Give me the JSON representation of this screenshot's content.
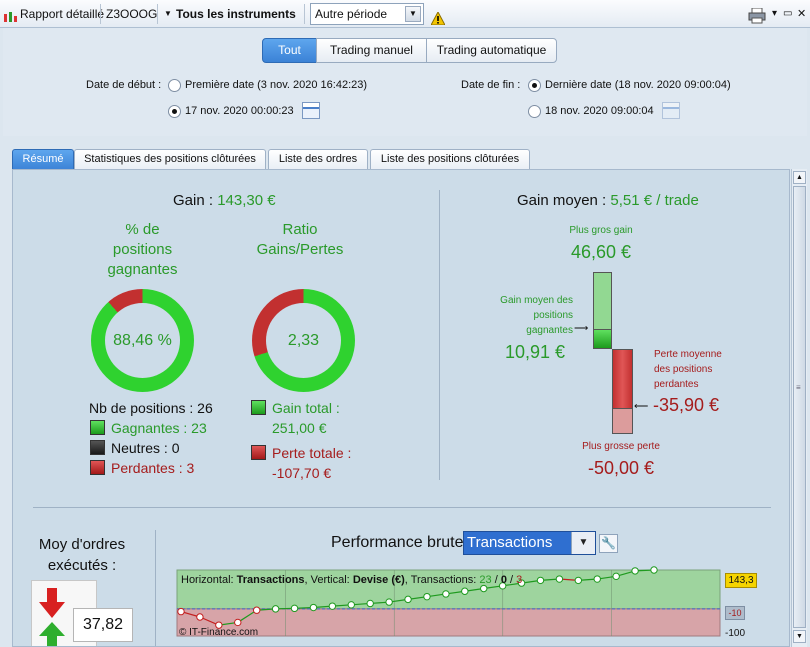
{
  "toolbar": {
    "report_label": "Rapport détaillé",
    "account": "Z3OOOG",
    "instruments": "Tous les instruments",
    "period_value": "Autre période",
    "warning_icon": "warning-icon",
    "print_icon": "printer-icon"
  },
  "filters": {
    "segments": [
      "Tout",
      "Trading manuel",
      "Trading automatique"
    ],
    "start_label": "Date de début :",
    "start_option1": "Première date (3 nov. 2020 16:42:23)",
    "start_option2": "17 nov. 2020 00:00:23",
    "end_label": "Date de fin :",
    "end_option1": "Dernière date (18 nov. 2020 09:00:04)",
    "end_option2": "18 nov. 2020 09:00:04"
  },
  "tabs": [
    "Résumé",
    "Statistiques des positions clôturées",
    "Liste des ordres",
    "Liste des positions clôturées"
  ],
  "summary": {
    "gain_label": "Gain :",
    "gain_value": "143,30 €",
    "winpct_title": "% de positions gagnantes",
    "winpct_value": "88,46 %",
    "winpct_fraction": 0.8846,
    "ratio_title": "Ratio Gains/Pertes",
    "ratio_value": "2,33",
    "ratio_fraction": 0.7,
    "nb_positions": "Nb de positions : 26",
    "winners": "Gagnantes : 23",
    "neutrals": "Neutres : 0",
    "losers": "Perdantes : 3",
    "total_gain_label": "Gain total :",
    "total_gain_value": "251,00 €",
    "total_loss_label": "Perte totale :",
    "total_loss_value": "-107,70 €"
  },
  "avg": {
    "label": "Gain moyen :",
    "value": "5,51 € / trade",
    "biggest_gain_label": "Plus gros gain",
    "biggest_gain_value": "46,60 €",
    "avg_win_label": "Gain moyen des positions gagnantes",
    "avg_win_value": "10,91 €",
    "avg_loss_label": "Perte moyenne des positions perdantes",
    "avg_loss_value": "-35,90 €",
    "biggest_loss_label": "Plus grosse perte",
    "biggest_loss_value": "-50,00 €"
  },
  "orders": {
    "title": "Moy d'ordres exécutés :",
    "value": "37,82"
  },
  "performance": {
    "title": "Performance brute",
    "select_value": "Transactions",
    "wrench_icon": "wrench-icon",
    "legend_horizontal": "Horizontal:",
    "legend_h_value": "Transactions",
    "legend_vertical": ", Vertical:",
    "legend_v_value": "Devise (€)",
    "legend_tx": ", Transactions:",
    "legend_counts": [
      "23",
      "0",
      "3"
    ],
    "copyright": "© IT-Finance.com",
    "right_labels": [
      "143,3",
      "-10",
      "-100"
    ]
  },
  "chart_data": {
    "type": "line",
    "x": [
      1,
      2,
      3,
      4,
      5,
      6,
      7,
      8,
      9,
      10,
      11,
      12,
      13,
      14,
      15,
      16,
      17,
      18,
      19,
      20,
      21,
      22,
      23,
      24,
      25,
      26
    ],
    "series": [
      {
        "values": [
          -10,
          -30,
          -60,
          -50,
          -5,
          0,
          2,
          5,
          10,
          15,
          20,
          25,
          35,
          45,
          55,
          65,
          75,
          85,
          95,
          105,
          110,
          105,
          110,
          120,
          140,
          143.3
        ]
      }
    ],
    "xlabel": "Transactions",
    "ylabel": "Devise (€)",
    "ylim": [
      -100,
      143.3
    ]
  },
  "colors": {
    "green": "#2a9a2a",
    "red": "#a51c1c",
    "accent": "#3b82d6"
  }
}
